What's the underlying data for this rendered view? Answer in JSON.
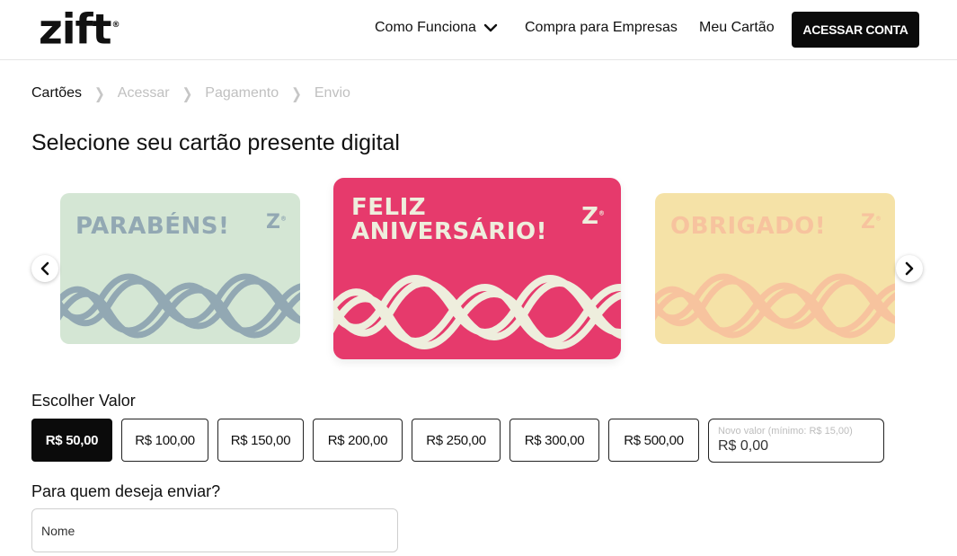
{
  "header": {
    "logo": "zift",
    "logo_mark": "®",
    "nav": {
      "como_funciona": "Como Funciona",
      "compra_empresas": "Compra para Empresas",
      "meu_cartao": "Meu Cartão"
    },
    "cta": "ACESSAR CONTA"
  },
  "breadcrumb": [
    "Cartões",
    "Acessar",
    "Pagamento",
    "Envio"
  ],
  "page_title": "Selecione seu cartão presente digital",
  "cards": [
    {
      "line1": "PARABÉNS!",
      "line2": "",
      "bg": "#d4e6d4",
      "fg": "#92a8b3"
    },
    {
      "line1": "FELIZ",
      "line2": "ANIVERSÁRIO!",
      "bg": "#e63a6c",
      "fg": "#eeeedd"
    },
    {
      "line1": "OBRIGADO!",
      "line2": "",
      "bg": "#f5e2a7",
      "fg": "#f7c39e"
    }
  ],
  "card_mark": "Z",
  "icons": {
    "prev": "chevron-left-icon",
    "next": "chevron-right-icon",
    "dropdown": "chevron-down-icon"
  },
  "valor": {
    "label": "Escolher Valor",
    "options": [
      "R$ 50,00",
      "R$ 100,00",
      "R$ 150,00",
      "R$ 200,00",
      "R$ 250,00",
      "R$ 300,00",
      "R$ 500,00"
    ],
    "selected": "R$ 50,00",
    "custom_placeholder": "Novo valor (mínimo: R$ 15,00)",
    "custom_value": "R$ 0,00"
  },
  "recipient": {
    "label": "Para quem deseja enviar?",
    "name_placeholder": "Nome"
  },
  "colors": {
    "accent_dark": "#0b0b0b",
    "card_pink": "#e63a6c"
  }
}
